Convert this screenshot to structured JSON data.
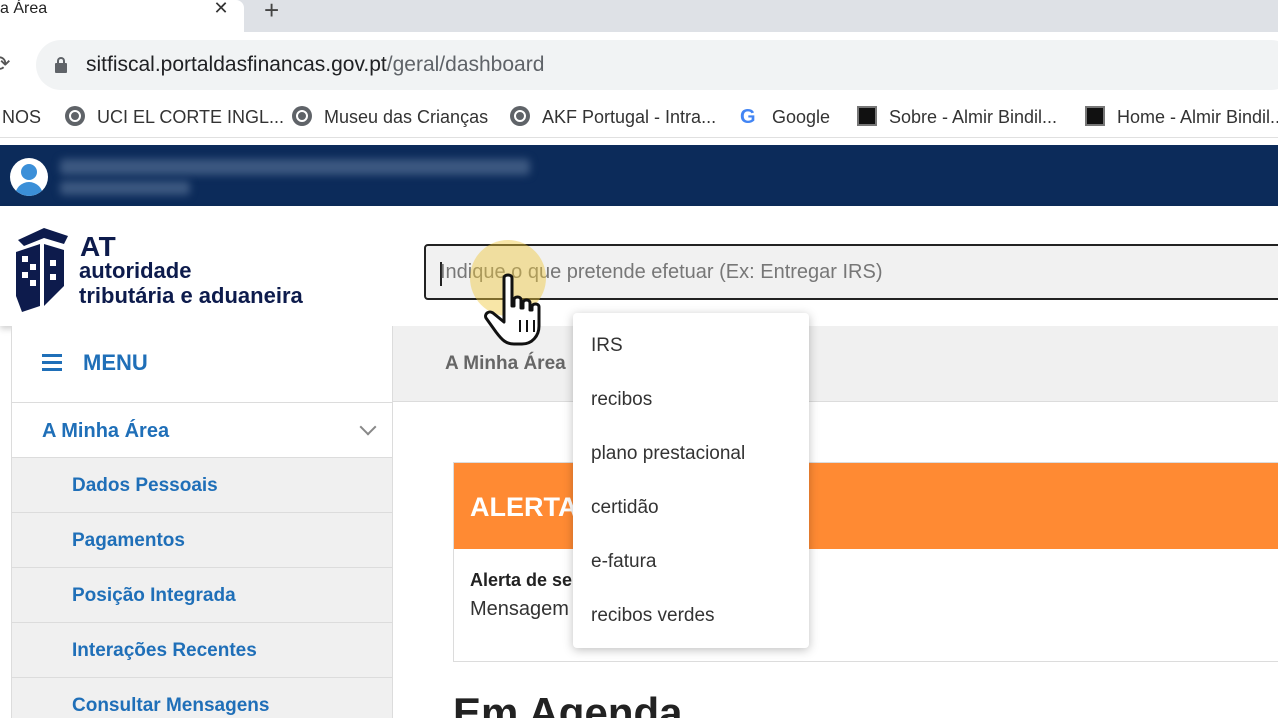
{
  "browser": {
    "tab_title": "a Área",
    "tab_close": "✕",
    "new_tab": "+",
    "reload": "⟳",
    "url_host": "sitfiscal.portaldasfinancas.gov.pt",
    "url_path": "/geral/dashboard",
    "bookmarks": [
      {
        "label": "NOS",
        "icon": "none"
      },
      {
        "label": "UCI EL CORTE INGL...",
        "icon": "globe-icon"
      },
      {
        "label": "Museu das Crianças",
        "icon": "globe-icon"
      },
      {
        "label": "AKF Portugal - Intra...",
        "icon": "globe-icon"
      },
      {
        "label": "Google",
        "icon": "google-icon"
      },
      {
        "label": "Sobre - Almir Bindil...",
        "icon": "site-favicon"
      },
      {
        "label": "Home - Almir Bindil...",
        "icon": "site-favicon"
      }
    ]
  },
  "site": {
    "logo_at": "AT",
    "logo_line1": "autoridade",
    "logo_line2": "tributária e aduaneira",
    "search_placeholder": "Indique o que pretende efetuar (Ex: Entregar IRS)",
    "brand_color": "#0c2b5a",
    "accent_color": "#1f6fb8",
    "alert_color": "#ff8a33"
  },
  "sidebar": {
    "menu_label": "MENU",
    "section": "A Minha Área",
    "items": [
      {
        "label": "Dados Pessoais"
      },
      {
        "label": "Pagamentos"
      },
      {
        "label": "Posição Integrada"
      },
      {
        "label": "Interações Recentes"
      },
      {
        "label": "Consultar Mensagens"
      }
    ]
  },
  "main": {
    "breadcrumb": "A Minha Área",
    "alert_title": "ALERTA",
    "alert_line1": "Alerta de se",
    "alert_line2": "Mensagem",
    "agenda_title": "Em Agenda"
  },
  "suggestions": [
    "IRS",
    "recibos",
    "plano prestacional",
    "certidão",
    "e-fatura",
    "recibos verdes"
  ]
}
